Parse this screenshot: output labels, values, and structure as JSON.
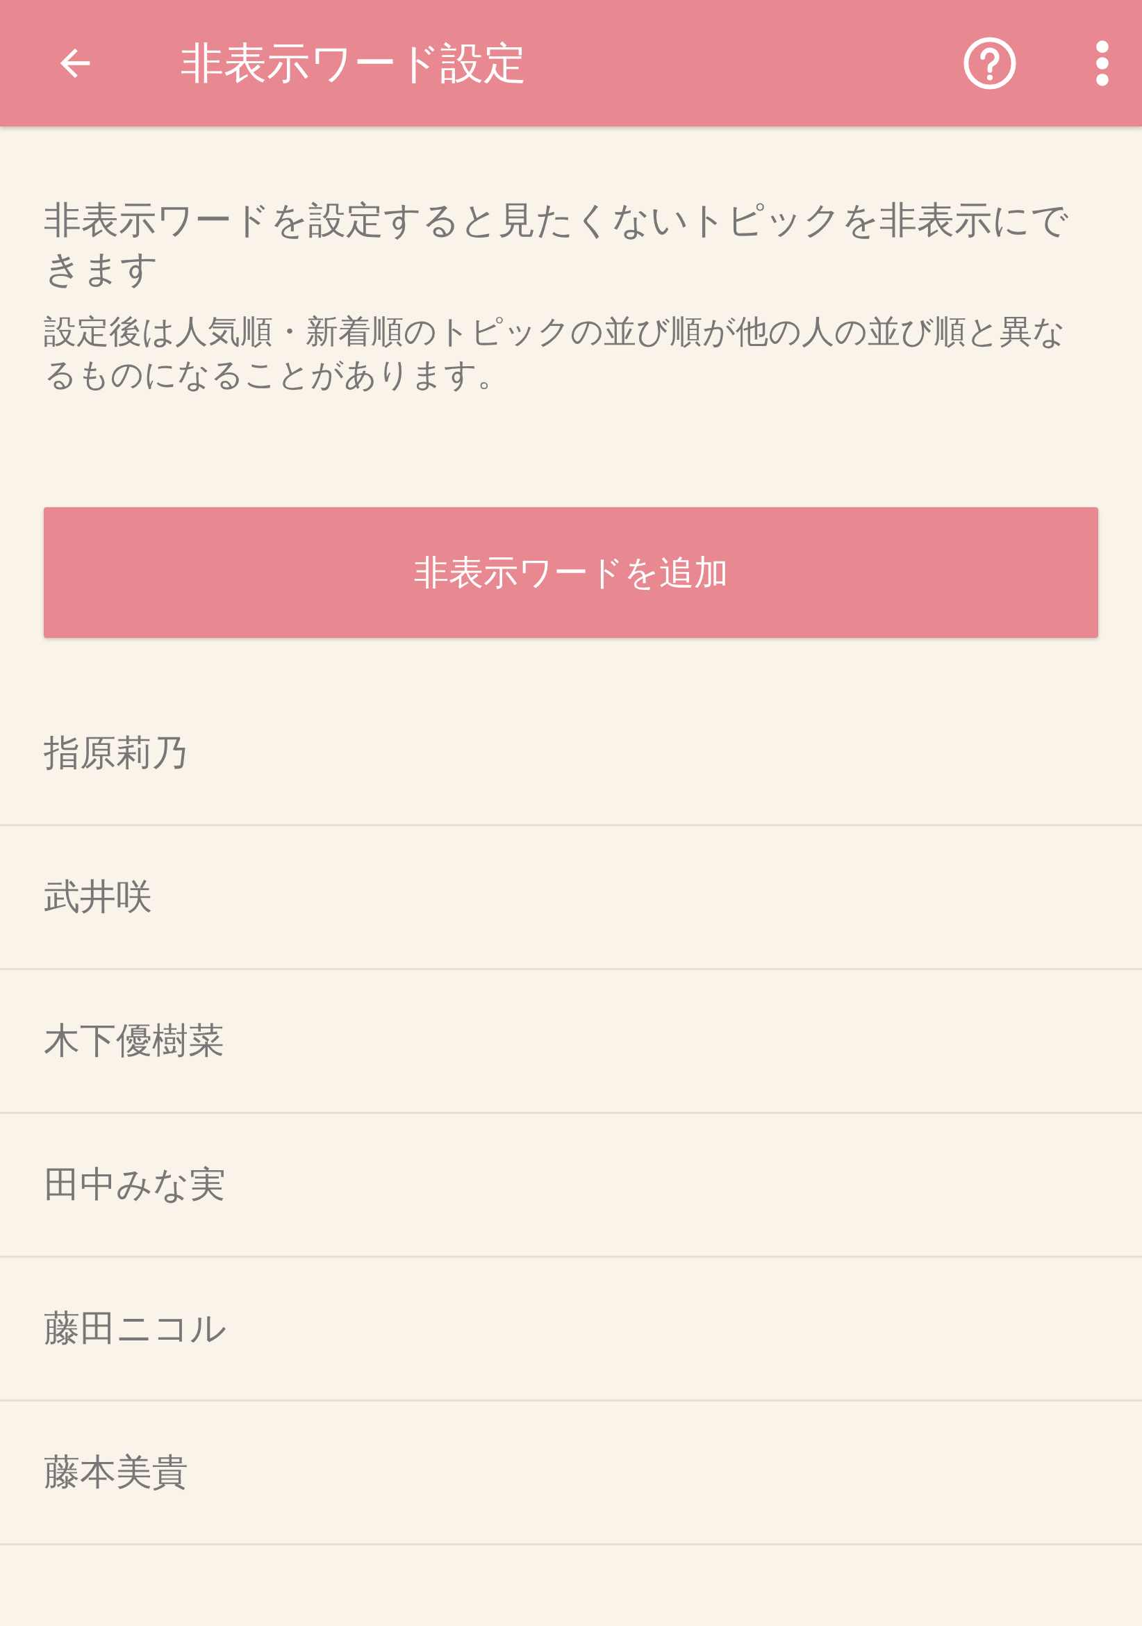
{
  "app_bar": {
    "title": "非表示ワード設定"
  },
  "description": "非表示ワードを設定すると見たくないトピックを非表示にできます",
  "note": "設定後は人気順・新着順のトピックの並び順が他の人の並び順と異なるものになることがあります。",
  "add_button": {
    "label": "非表示ワードを追加"
  },
  "words": [
    "指原莉乃",
    "武井咲",
    "木下優樹菜",
    "田中みな実",
    "藤田ニコル",
    "藤本美貴"
  ]
}
